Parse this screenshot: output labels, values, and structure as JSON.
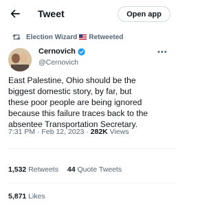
{
  "header": {
    "title": "Tweet",
    "open_app_label": "Open app",
    "back_icon": "arrow-left-icon"
  },
  "social_context": {
    "name": "Election Wizard",
    "flag": "us-flag",
    "action": "Retweeted"
  },
  "tweet": {
    "author_name": "Cernovich",
    "author_handle": "@Cernovich",
    "verified": true,
    "text_lines": [
      "East Palestine, Ohio should be the",
      "biggest domestic story, by far, but",
      "these poor people are being ignored",
      "because this failure traces back to the",
      "absentee Transportation Secretary."
    ],
    "timestamp": "7:31 PM · Feb 12, 2023 · ",
    "views_count": "282K",
    "views_label": " Views"
  },
  "stats": {
    "retweets_count": "1,532",
    "retweets_label": " Retweets",
    "quotes_count": "44",
    "quotes_label": " Quote Tweets",
    "likes_count": "5,871",
    "likes_label": " Likes"
  },
  "colors": {
    "verified": "#1d9bf0",
    "secondary_text": "#536471",
    "primary_text": "#0f1419",
    "border": "#eff3f4"
  }
}
